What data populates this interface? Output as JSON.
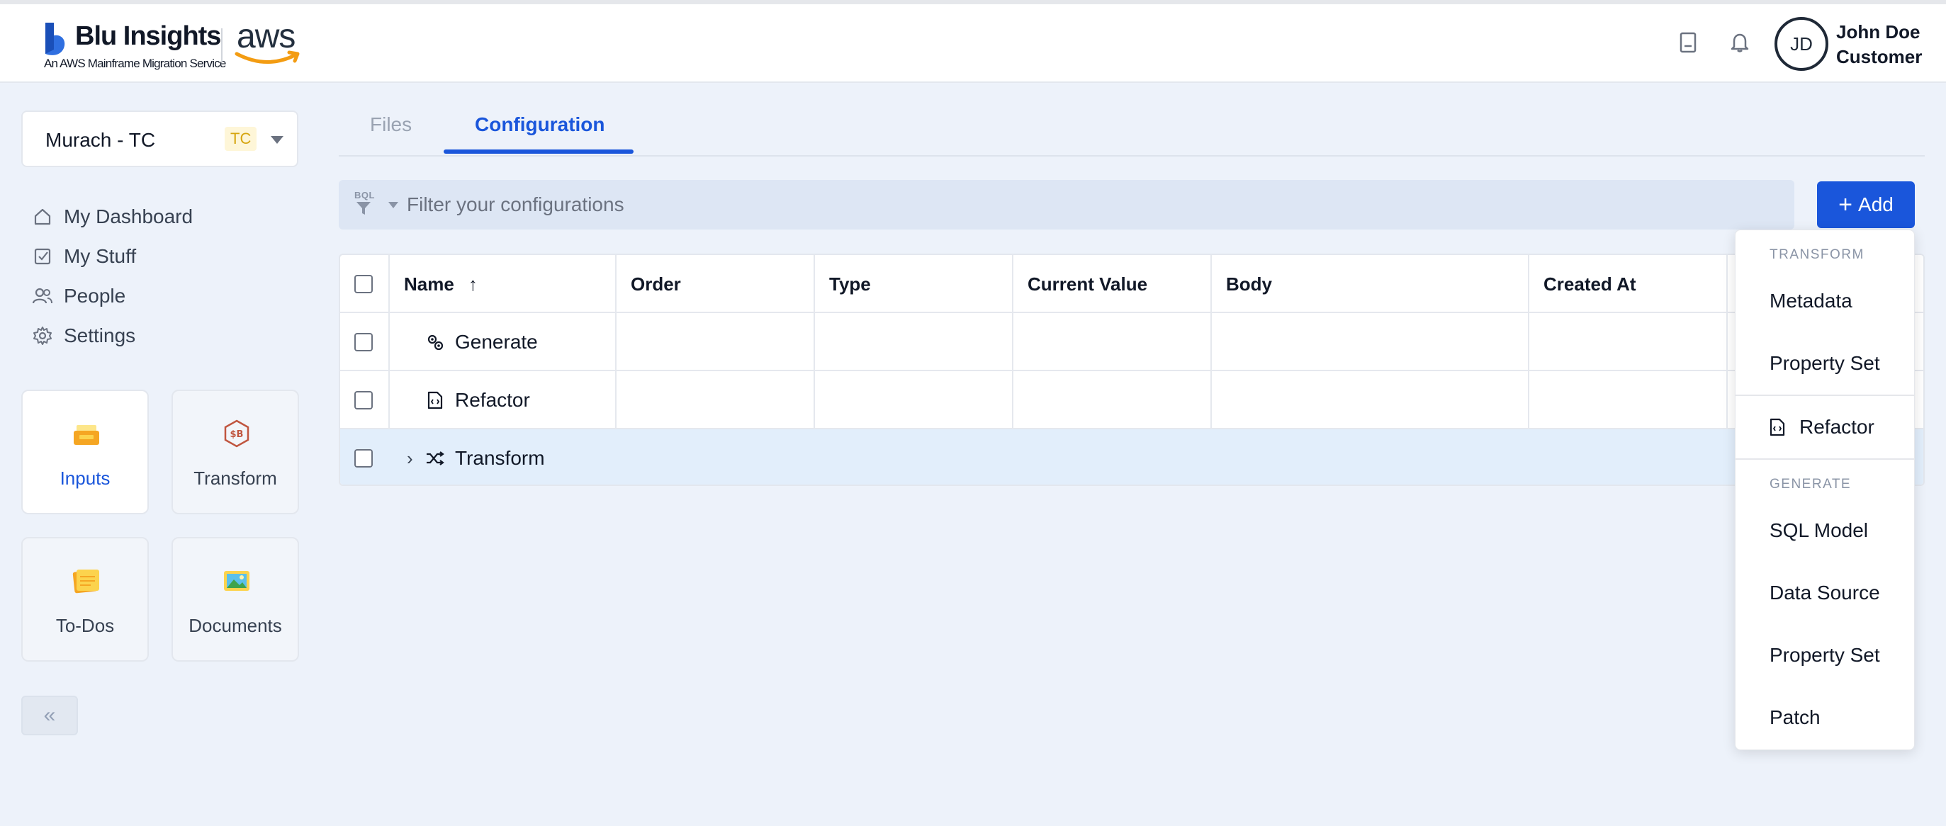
{
  "header": {
    "brand_name": "Blu Insights",
    "brand_tagline": "An AWS Mainframe Migration Service",
    "partner_logo": "aws",
    "icons": [
      "book-icon",
      "bell-icon"
    ],
    "user": {
      "initials": "JD",
      "name": "John Doe",
      "role": "Customer"
    }
  },
  "sidebar": {
    "project": {
      "name": "Murach - TC",
      "badge": "TC"
    },
    "nav": [
      {
        "label": "My Dashboard",
        "icon": "home-icon"
      },
      {
        "label": "My Stuff",
        "icon": "checkbox-icon"
      },
      {
        "label": "People",
        "icon": "people-icon"
      },
      {
        "label": "Settings",
        "icon": "gear-icon"
      }
    ],
    "tiles": [
      {
        "label": "Inputs",
        "icon": "inbox-tray-icon",
        "active": true
      },
      {
        "label": "Transform",
        "icon": "hexagon-transform-icon",
        "active": false
      },
      {
        "label": "To-Dos",
        "icon": "sticky-notes-icon",
        "active": false
      },
      {
        "label": "Documents",
        "icon": "picture-frame-icon",
        "active": false
      }
    ],
    "collapse_label": "«"
  },
  "tabs": [
    {
      "label": "Files",
      "active": false
    },
    {
      "label": "Configuration",
      "active": true
    }
  ],
  "filter": {
    "badge": "BQL",
    "placeholder": "Filter your configurations"
  },
  "add_button": {
    "label": "Add"
  },
  "table": {
    "columns": [
      "Name",
      "Order",
      "Type",
      "Current Value",
      "Body",
      "Created At"
    ],
    "sort_indicator": "↑",
    "rows": [
      {
        "name": "Generate",
        "icon": "gears-icon",
        "expandable": false
      },
      {
        "name": "Refactor",
        "icon": "file-code-icon",
        "expandable": false
      },
      {
        "name": "Transform",
        "icon": "shuffle-icon",
        "expandable": true,
        "highlighted": true
      }
    ]
  },
  "dropdown": {
    "sections": [
      {
        "header": "TRANSFORM",
        "items": [
          "Metadata",
          "Property Set"
        ]
      },
      {
        "header": "",
        "items": [
          "Refactor"
        ]
      },
      {
        "header": "GENERATE",
        "items": [
          "SQL Model",
          "Data Source",
          "Property Set",
          "Patch"
        ]
      }
    ]
  },
  "colors": {
    "accent": "#1a56db",
    "background": "#edf2fa",
    "row_highlight": "#e2eefb"
  }
}
